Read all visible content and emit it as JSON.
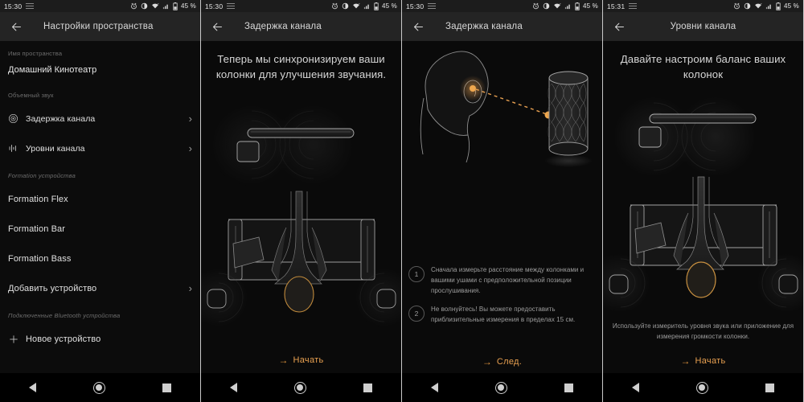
{
  "accent": "#e8a050",
  "panels": [
    {
      "id": "space-settings",
      "statusbar": {
        "time": "15:30",
        "battery": "45 %"
      },
      "appbar": {
        "title": "Настройки пространства",
        "back_icon": "arrow-left-icon"
      },
      "sections": [
        {
          "label": "Имя пространства",
          "value": "Домашний Кинотеатр"
        },
        {
          "label": "Объемный звук",
          "rows": [
            {
              "icon": "channel-delay-icon",
              "label": "Задержка канала",
              "chevron": "›"
            },
            {
              "icon": "channel-levels-icon",
              "label": "Уровни канала",
              "chevron": "›"
            }
          ]
        },
        {
          "label": "Formation устройства",
          "rows": [
            {
              "icon": "",
              "label": "Formation Flex",
              "chevron": ""
            },
            {
              "icon": "",
              "label": "Formation Bar",
              "chevron": ""
            },
            {
              "icon": "",
              "label": "Formation Bass",
              "chevron": ""
            },
            {
              "icon": "",
              "label": "Добавить устройство",
              "chevron": "›"
            }
          ]
        },
        {
          "label": "Подключенные Bluetooth устройства",
          "rows": [
            {
              "icon": "plus-icon",
              "label": "Новое устройство",
              "chevron": ""
            }
          ]
        }
      ]
    },
    {
      "id": "channel-delay-intro",
      "statusbar": {
        "time": "15:30",
        "battery": "45 %"
      },
      "appbar": {
        "title": "Задержка канала",
        "back_icon": "arrow-left-icon"
      },
      "title": "Теперь мы синхронизируем ваши колонки для улучшения звучания.",
      "cta": {
        "arrow": "→",
        "label": "Начать"
      }
    },
    {
      "id": "channel-delay-measure",
      "statusbar": {
        "time": "15:30",
        "battery": "45 %"
      },
      "appbar": {
        "title": "Задержка канала",
        "back_icon": "arrow-left-icon"
      },
      "steps": [
        {
          "num": "1",
          "text": "Сначала измерьте расстояние между колонками и вашими ушами с предположительной позиции прослушивания."
        },
        {
          "num": "2",
          "text": "Не волнуйтесь! Вы можете предоставить приблизительные измерения в пределах 15 см."
        }
      ],
      "cta": {
        "arrow": "→",
        "label": "След."
      }
    },
    {
      "id": "channel-levels-intro",
      "statusbar": {
        "time": "15:31",
        "battery": "45 %"
      },
      "appbar": {
        "title": "Уровни канала",
        "back_icon": "arrow-left-icon"
      },
      "title": "Давайте настроим баланс ваших колонок",
      "note": "Используйте измеритель уровня звука или приложение для измерения громкости колонки.",
      "cta": {
        "arrow": "→",
        "label": "Начать"
      }
    }
  ],
  "navbar": {
    "back": "nav-back-icon",
    "home": "nav-home-icon",
    "recent": "nav-recent-icon"
  }
}
